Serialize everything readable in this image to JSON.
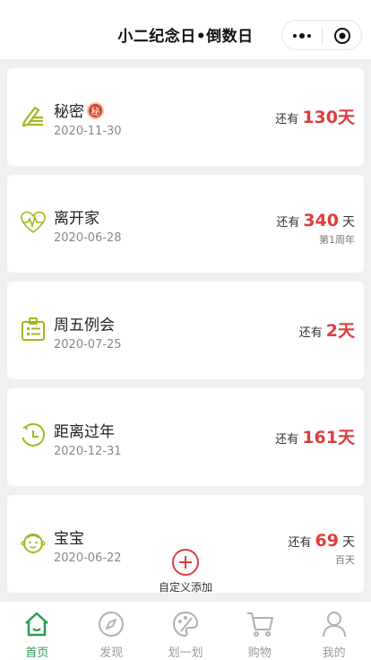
{
  "header": {
    "title": "小二纪念日•倒数日"
  },
  "cards": [
    {
      "name": "秘密",
      "badge": "秘",
      "date": "2020-11-30",
      "prefix": "还有",
      "number": "130",
      "unit": "天",
      "sub": "",
      "icon": "pen-document-icon"
    },
    {
      "name": "离开家",
      "badge": "",
      "date": "2020-06-28",
      "prefix": "还有",
      "number": "340",
      "unit": "天",
      "sub": "第1周年",
      "icon": "heart-pulse-icon"
    },
    {
      "name": "周五例会",
      "badge": "",
      "date": "2020-07-25",
      "prefix": "还有",
      "number": "2",
      "unit": "天",
      "sub": "",
      "icon": "id-badge-icon"
    },
    {
      "name": "距离过年",
      "badge": "",
      "date": "2020-12-31",
      "prefix": "还有",
      "number": "161",
      "unit": "天",
      "sub": "",
      "icon": "clock-icon"
    },
    {
      "name": "宝宝",
      "badge": "",
      "date": "2020-06-22",
      "prefix": "还有",
      "number": "69",
      "unit": "天",
      "sub": "百天",
      "icon": "baby-face-icon"
    }
  ],
  "add_button": {
    "label": "自定义添加"
  },
  "tabs": [
    {
      "label": "首页",
      "icon": "home-icon",
      "active": true
    },
    {
      "label": "发现",
      "icon": "compass-icon",
      "active": false
    },
    {
      "label": "划一划",
      "icon": "palette-icon",
      "active": false
    },
    {
      "label": "购物",
      "icon": "cart-icon",
      "active": false
    },
    {
      "label": "我的",
      "icon": "user-icon",
      "active": false
    }
  ],
  "colors": {
    "accent_red": "#e03c3c",
    "icon_green": "#a6b51f",
    "tab_active": "#2c9a56",
    "tab_inactive": "#999999"
  }
}
